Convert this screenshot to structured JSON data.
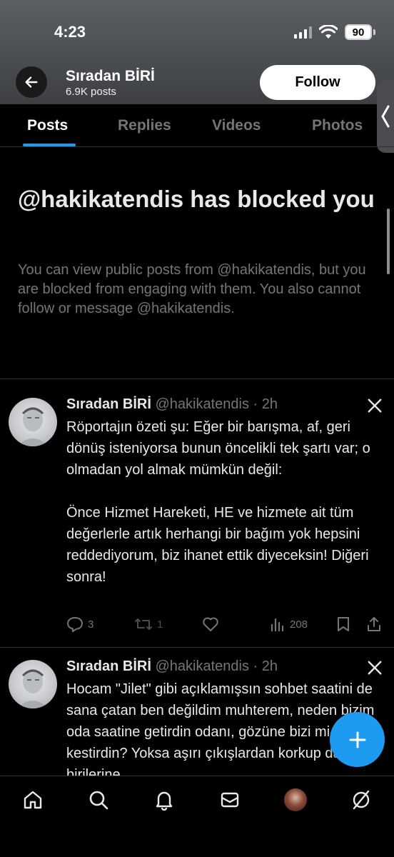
{
  "status_bar": {
    "time": "4:23",
    "battery": "90"
  },
  "header": {
    "name": "Sıradan BİRİ",
    "posts_count": "6.9K posts",
    "follow_label": "Follow"
  },
  "tabs": [
    {
      "label": "Posts",
      "active": true
    },
    {
      "label": "Replies",
      "active": false
    },
    {
      "label": "Videos",
      "active": false
    },
    {
      "label": "Photos",
      "active": false
    }
  ],
  "blocked": {
    "title": "@hakikatendis has blocked you",
    "text": "You can view public posts from @hakikatendis, but you are blocked from engaging with them. You also cannot follow or message @hakikatendis."
  },
  "posts": [
    {
      "author_name": "Sıradan BİRİ",
      "author_handle": "@hakikatendis",
      "time": "· 2h",
      "text": "Röportajın özeti şu: Eğer bir barışma, af, geri dönüş isteniyorsa bunun öncelikli tek şartı var; o olmadan yol almak mümkün değil:\n\nÖnce Hizmet Hareketi, HE ve hizmete ait tüm değerlerle artık herhangi bir bağım yok hepsini reddediyorum, biz ihanet ettik diyeceksin! Diğeri sonra!",
      "replies": "3",
      "reposts": "1",
      "views": "208"
    },
    {
      "author_name": "Sıradan BİRİ",
      "author_handle": "@hakikatendis",
      "time": "· 2h",
      "text": "Hocam \"Jilet\" gibi açıklamışsın sohbet saatini de sana çatan ben değildim muhterem, neden bizim oda saatine getirdin odanı, gözüne bizi mi kestirdin? Yoksa aşırı çıkışlardan korkup da birilerine"
    }
  ],
  "colors": {
    "accent": "#1d9bf0",
    "background": "#000000",
    "muted": "#71767b"
  }
}
